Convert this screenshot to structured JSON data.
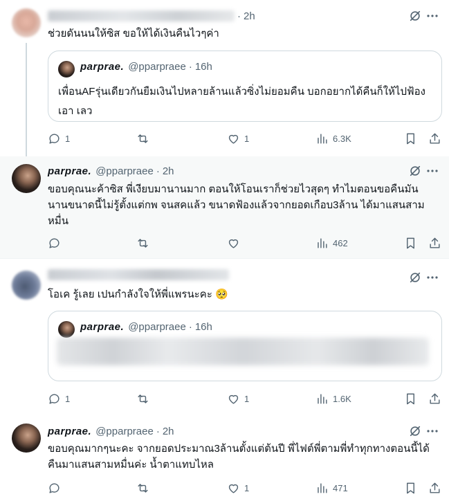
{
  "tweets": [
    {
      "id": "t1",
      "author_name": "",
      "author_handle": "",
      "time": "2h",
      "text": "ช่วยดันนนให้ซิส ขอให้ได้เงินคืนไวๆค่า",
      "quote": {
        "author_name": "parprae.",
        "author_handle": "@pparpraee",
        "time": "16h",
        "text": "เพื่อนAFรุ่นเดียวกันยืมเงินไปหลายล้านแล้วซิ่งไม่ยอมคืน บอกอยากได้คืนก็ให้ไปฟ้องเอา เลว"
      },
      "stats": {
        "replies": "1",
        "reposts": "",
        "likes": "1",
        "views": "6.3K"
      }
    },
    {
      "id": "t2",
      "author_name": "parprae.",
      "author_handle": "@pparpraee",
      "time": "2h",
      "text": "ขอบคุณนะค้าซิส พี่เงียบมานานมาก ตอนให้โอนเราก็ช่วยไวสุดๆ ทำไมตอนขอคืนมันนานขนาดนี้ไม่รู้ตั้งแต่กพ จนสคแล้ว ขนาดฟ้องแล้วจากยอดเกือบ3ล้าน ได้มาแสนสามหมื่น",
      "stats": {
        "replies": "",
        "reposts": "",
        "likes": "",
        "views": "462"
      }
    },
    {
      "id": "t3",
      "author_name": "",
      "author_handle": "",
      "time": "",
      "text": "โอเค รู้เลย เปนกำลังใจให้พี่แพรนะคะ 🥺",
      "quote": {
        "author_name": "parprae.",
        "author_handle": "@pparpraee",
        "time": "16h",
        "text": ""
      },
      "stats": {
        "replies": "1",
        "reposts": "",
        "likes": "1",
        "views": "1.6K"
      }
    },
    {
      "id": "t4",
      "author_name": "parprae.",
      "author_handle": "@pparpraee",
      "time": "2h",
      "text": "ขอบคุณมากๆนะคะ จากยอดประมาณ3ล้านตั้งแต่ต้นปี พี่ไฟต์พี่ตามพี่ทำทุกทางตอนนี้ได้คืนมาแสนสามหมื่นค่ะ น้ำตาแทบไหล",
      "stats": {
        "replies": "",
        "reposts": "",
        "likes": "1",
        "views": "471"
      }
    }
  ],
  "icons": [
    "reply-icon",
    "repost-icon",
    "like-icon",
    "views-icon",
    "bookmark-icon",
    "share-icon",
    "grok-icon",
    "more-icon"
  ],
  "colors": {
    "text": "#0f1419",
    "muted": "#536471",
    "border": "#cfd9de",
    "highlight_bg": "#f7f9f9"
  }
}
